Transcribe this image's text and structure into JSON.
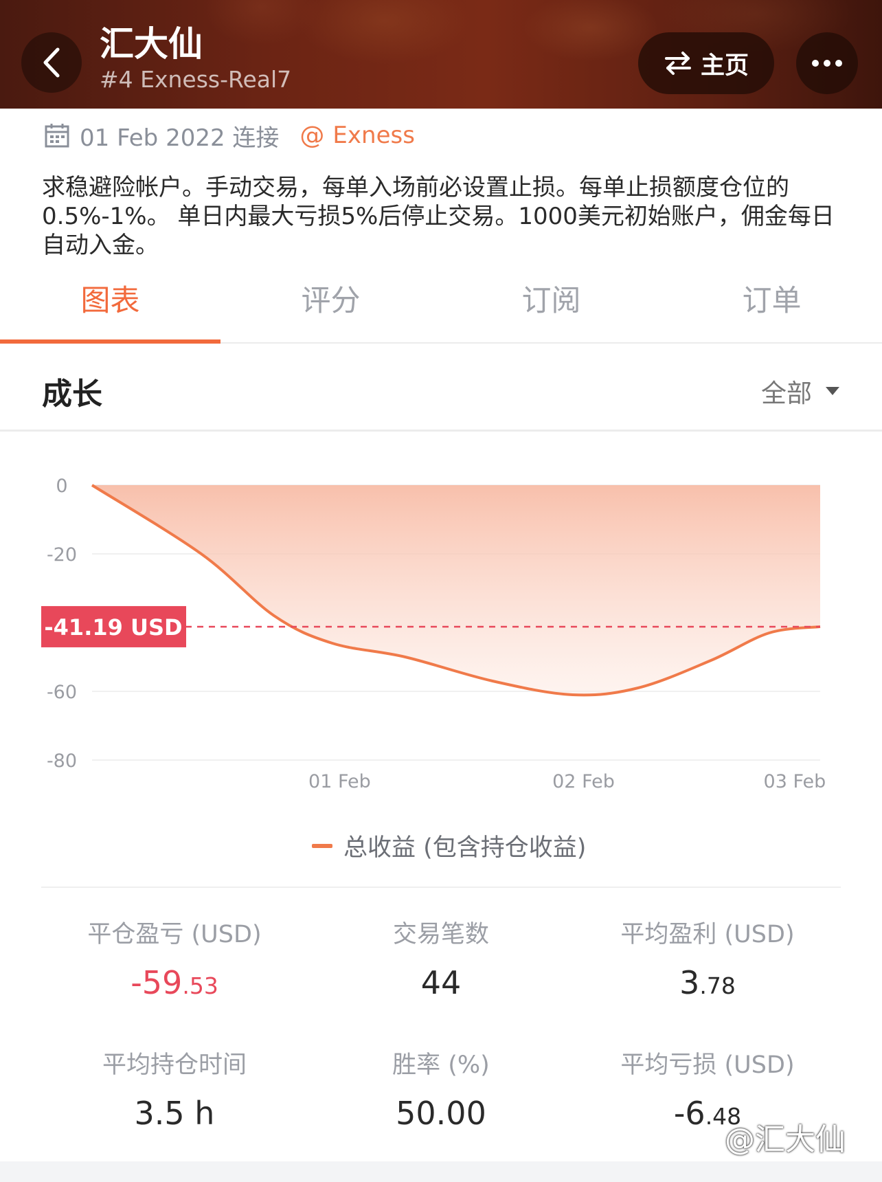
{
  "header": {
    "title": "汇大仙",
    "subtitle": "#4 Exness-Real7",
    "home_label": "主页"
  },
  "info": {
    "date_text": "01 Feb 2022 连接",
    "at_symbol": "@",
    "broker": "Exness"
  },
  "description": "求稳避险帐户。手动交易，每单入场前必设置止损。每单止损额度仓位的0.5%-1%。 单日内最大亏损5%后停止交易。1000美元初始账户，佣金每日自动入金。",
  "tabs": [
    {
      "label": "图表",
      "active": true
    },
    {
      "label": "评分",
      "active": false
    },
    {
      "label": "订阅",
      "active": false
    },
    {
      "label": "订单",
      "active": false
    }
  ],
  "section": {
    "title": "成长",
    "range": "全部"
  },
  "chart_data": {
    "type": "area",
    "y_ticks": [
      "0",
      "-20",
      "-60",
      "-80"
    ],
    "ylim": [
      -80,
      0
    ],
    "x_ticks": [
      "01 Feb",
      "02 Feb",
      "03 Feb"
    ],
    "series": [
      {
        "name": "总收益 (包含持仓收益)",
        "color": "#f07a4a",
        "points": [
          {
            "t": 0.0,
            "y": 0
          },
          {
            "t": 0.15,
            "y": -20
          },
          {
            "t": 0.25,
            "y": -38
          },
          {
            "t": 0.33,
            "y": -46
          },
          {
            "t": 0.43,
            "y": -50
          },
          {
            "t": 0.55,
            "y": -57
          },
          {
            "t": 0.66,
            "y": -61
          },
          {
            "t": 0.75,
            "y": -59
          },
          {
            "t": 0.85,
            "y": -51
          },
          {
            "t": 0.93,
            "y": -43
          },
          {
            "t": 1.0,
            "y": -41.19
          }
        ]
      }
    ],
    "current_value_label": "-41.19 USD",
    "current_value": -41.19,
    "reference_line_color": "#e8485a"
  },
  "stats": [
    {
      "label": "平仓盈亏 (USD)",
      "value_main": "-59",
      "value_small": ".53",
      "negative": true
    },
    {
      "label": "交易笔数",
      "value_main": "44",
      "value_small": "",
      "negative": false
    },
    {
      "label": "平均盈利 (USD)",
      "value_main": "3",
      "value_small": ".78",
      "negative": false
    },
    {
      "label": "平均持仓时间",
      "value_main": "3.5 h",
      "value_small": "",
      "negative": false
    },
    {
      "label": "胜率 (%)",
      "value_main": "50.00",
      "value_small": "",
      "negative": false
    },
    {
      "label": "平均亏损 (USD)",
      "value_main": "-6",
      "value_small": ".48",
      "negative": false
    }
  ],
  "watermark": "@汇大仙"
}
